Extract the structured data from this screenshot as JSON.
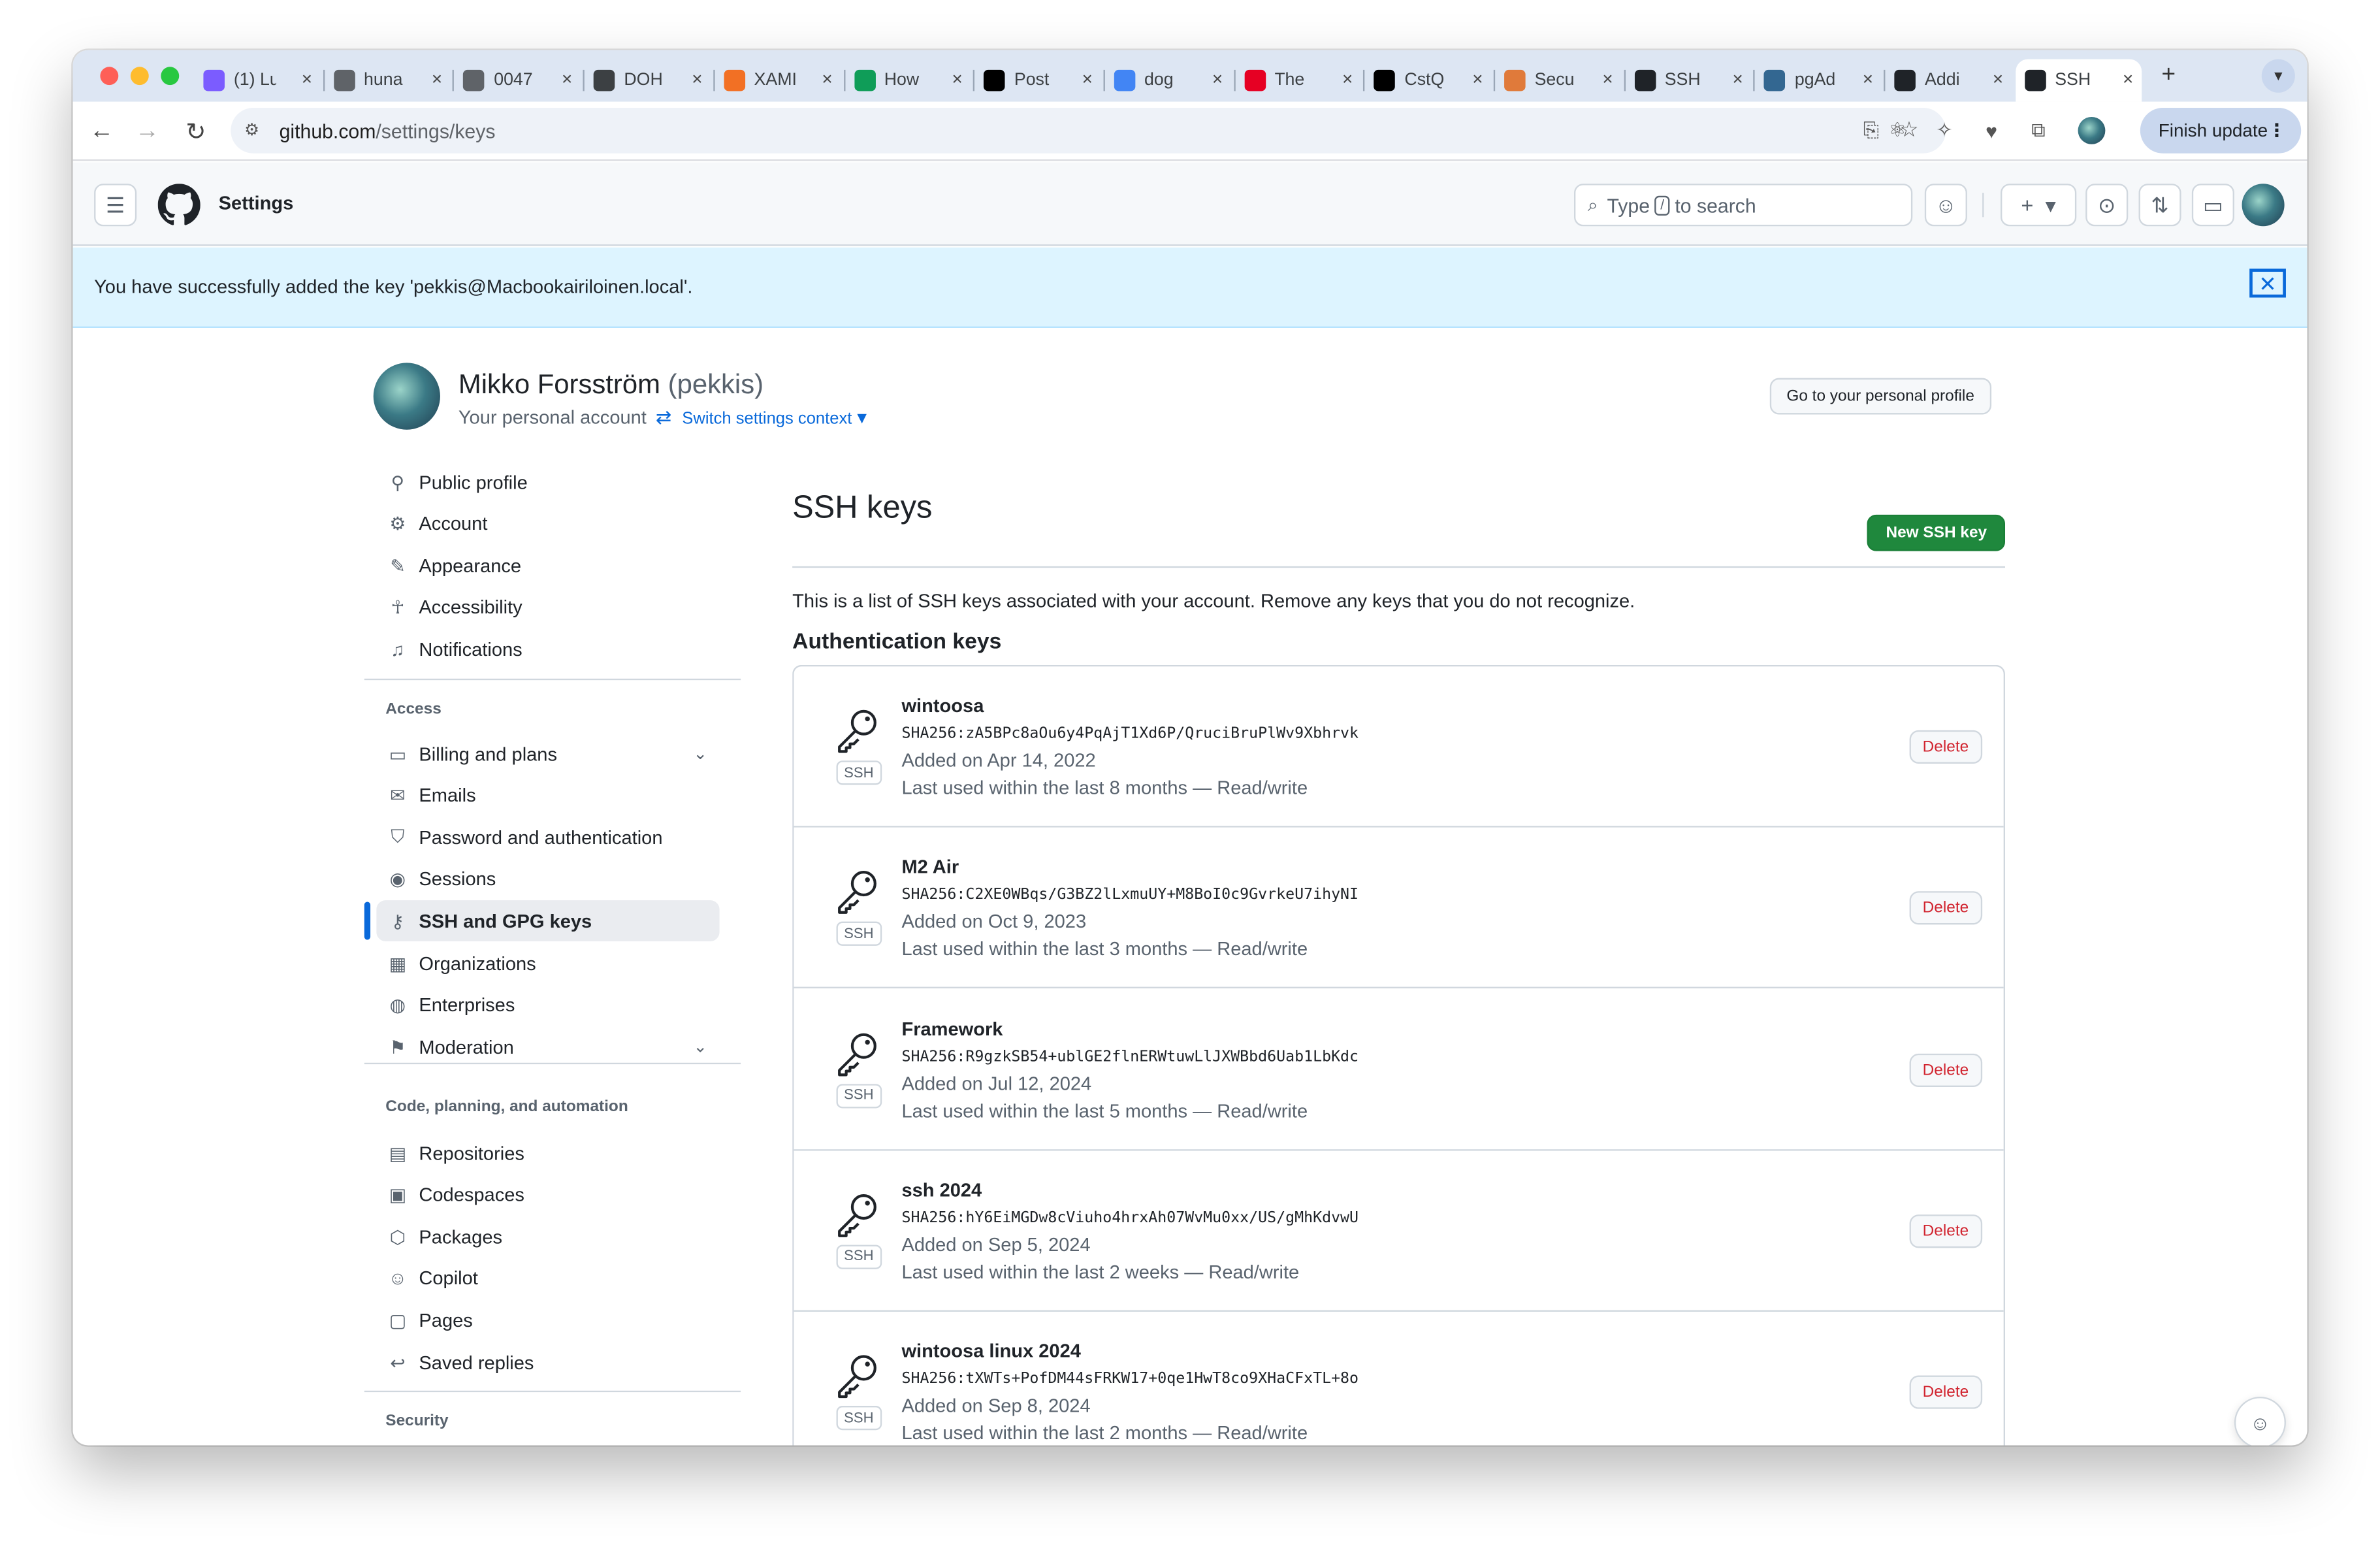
{
  "browser": {
    "tabs": [
      {
        "title": "(1) Lu",
        "icon": "messenger-icon",
        "color": "#7b5cff"
      },
      {
        "title": "huna",
        "icon": "globe-icon",
        "color": "#5f6368"
      },
      {
        "title": "0047",
        "icon": "globe-icon",
        "color": "#5f6368"
      },
      {
        "title": "DOH",
        "icon": "wordpress-icon",
        "color": "#3c4043"
      },
      {
        "title": "XAMI",
        "icon": "xampp-icon",
        "color": "#f27024"
      },
      {
        "title": "How",
        "icon": "sheets-icon",
        "color": "#0f9d58"
      },
      {
        "title": "Post",
        "icon": "medium-icon",
        "color": "#000000"
      },
      {
        "title": "dog",
        "icon": "google-icon",
        "color": "#4285f4"
      },
      {
        "title": "The",
        "icon": "pinterest-icon",
        "color": "#e60023"
      },
      {
        "title": "CstQ",
        "icon": "x-icon",
        "color": "#000000"
      },
      {
        "title": "Secu",
        "icon": "shield-app-icon",
        "color": "#e07a3a"
      },
      {
        "title": "SSH",
        "icon": "github-icon",
        "color": "#1f2328"
      },
      {
        "title": "pgAd",
        "icon": "pgadmin-icon",
        "color": "#336791"
      },
      {
        "title": "Addi",
        "icon": "github-icon",
        "color": "#1f2328"
      },
      {
        "title": "SSH",
        "icon": "github-icon",
        "color": "#1f2328",
        "active": true
      }
    ],
    "url_host": "github.com",
    "url_path": "/settings/keys",
    "finish_update": "Finish update"
  },
  "header": {
    "title": "Settings",
    "search_prefix": "Type",
    "search_key": "/",
    "search_suffix": "to search"
  },
  "flash": {
    "message": "You have successfully added the key 'pekkis@Macbookairiloinen.local'.",
    "close": "✕"
  },
  "profile": {
    "name": "Mikko Forsström",
    "handle": "(pekkis)",
    "subtitle": "Your personal account",
    "switch": "Switch settings context",
    "goto": "Go to your personal profile"
  },
  "sidebar": {
    "items": [
      {
        "label": "Public profile",
        "icon": "person-icon"
      },
      {
        "label": "Account",
        "icon": "gear-icon"
      },
      {
        "label": "Appearance",
        "icon": "paintbrush-icon"
      },
      {
        "label": "Accessibility",
        "icon": "accessibility-icon"
      },
      {
        "label": "Notifications",
        "icon": "bell-icon"
      }
    ],
    "access_head": "Access",
    "access": [
      {
        "label": "Billing and plans",
        "icon": "credit-card-icon",
        "expandable": true
      },
      {
        "label": "Emails",
        "icon": "mail-icon"
      },
      {
        "label": "Password and authentication",
        "icon": "shield-lock-icon"
      },
      {
        "label": "Sessions",
        "icon": "broadcast-icon"
      },
      {
        "label": "SSH and GPG keys",
        "icon": "key-icon",
        "selected": true
      },
      {
        "label": "Organizations",
        "icon": "organization-icon"
      },
      {
        "label": "Enterprises",
        "icon": "globe-icon"
      },
      {
        "label": "Moderation",
        "icon": "report-icon",
        "expandable": true
      }
    ],
    "code_head": "Code, planning, and automation",
    "code": [
      {
        "label": "Repositories",
        "icon": "repo-icon"
      },
      {
        "label": "Codespaces",
        "icon": "codespaces-icon"
      },
      {
        "label": "Packages",
        "icon": "package-icon"
      },
      {
        "label": "Copilot",
        "icon": "copilot-icon"
      },
      {
        "label": "Pages",
        "icon": "browser-icon"
      },
      {
        "label": "Saved replies",
        "icon": "reply-icon"
      }
    ],
    "security_head": "Security"
  },
  "main": {
    "title": "SSH keys",
    "new_key": "New SSH key",
    "description": "This is a list of SSH keys associated with your account. Remove any keys that you do not recognize.",
    "auth_head": "Authentication keys",
    "badge": "SSH",
    "delete": "Delete",
    "keys": [
      {
        "title": "wintoosa",
        "fingerprint": "SHA256:zA5BPc8aOu6y4PqAjT1Xd6P/QruciBruPlWv9Xbhrvk",
        "added": "Added on Apr 14, 2022",
        "used": "Last used within the last 8 months — Read/write"
      },
      {
        "title": "M2 Air",
        "fingerprint": "SHA256:C2XE0WBqs/G3BZ2lLxmuUY+M8BoI0c9GvrkeU7ihyNI",
        "added": "Added on Oct 9, 2023",
        "used": "Last used within the last 3 months — Read/write"
      },
      {
        "title": "Framework",
        "fingerprint": "SHA256:R9gzkSB54+ublGE2flnERWtuwLlJXWBbd6Uab1LbKdc",
        "added": "Added on Jul 12, 2024",
        "used": "Last used within the last 5 months — Read/write"
      },
      {
        "title": "ssh 2024",
        "fingerprint": "SHA256:hY6EiMGDw8cViuho4hrxAh07WvMu0xx/US/gMhKdvwU",
        "added": "Added on Sep 5, 2024",
        "used": "Last used within the last 2 weeks — Read/write"
      },
      {
        "title": "wintoosa linux 2024",
        "fingerprint": "SHA256:tXWTs+PofDM44sFRKW17+0qe1HwT8co9XHaCFxTL+8o",
        "added": "Added on Sep 8, 2024",
        "used": "Last used within the last 2 months — Read/write"
      }
    ]
  }
}
